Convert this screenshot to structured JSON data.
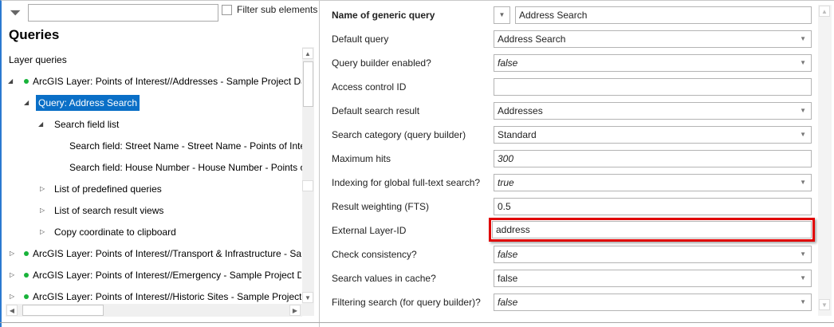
{
  "filter": {
    "placeholder": "",
    "checkbox_label": "Filter sub elements"
  },
  "title": "Queries",
  "section": "Layer queries",
  "tree": [
    {
      "label": "ArcGIS Layer: Points of Interest//Addresses - Sample Project Data - ..."
    },
    {
      "label": "Query: Address Search"
    },
    {
      "label": "Search field list"
    },
    {
      "label": "Search field: Street Name - Street Name - Points of Interest"
    },
    {
      "label": "Search field: House Number - House Number - Points of Interest"
    },
    {
      "label": "List of predefined queries"
    },
    {
      "label": "List of search result views"
    },
    {
      "label": "Copy coordinate to clipboard"
    },
    {
      "label": "ArcGIS Layer: Points of Interest//Transport & Infrastructure - Sample Project Data"
    },
    {
      "label": "ArcGIS Layer: Points of Interest//Emergency - Sample Project Data - ..."
    },
    {
      "label": "ArcGIS Layer: Points of Interest//Historic Sites - Sample Project Data"
    }
  ],
  "form": [
    {
      "label": "Name of generic query",
      "value": "Address Search"
    },
    {
      "label": "Default query",
      "value": "Address Search"
    },
    {
      "label": "Query builder enabled?",
      "value": "false"
    },
    {
      "label": "Access control ID",
      "value": ""
    },
    {
      "label": "Default search result",
      "value": "Addresses"
    },
    {
      "label": "Search category (query builder)",
      "value": "Standard"
    },
    {
      "label": "Maximum hits",
      "value": "300"
    },
    {
      "label": "Indexing for global full-text search?",
      "value": "true"
    },
    {
      "label": "Result weighting (FTS)",
      "value": "0.5"
    },
    {
      "label": "External Layer-ID",
      "value": "address"
    },
    {
      "label": "Check consistency?",
      "value": "false"
    },
    {
      "label": "Search values in cache?",
      "value": "false"
    },
    {
      "label": "Filtering search (for query builder)?",
      "value": "false"
    }
  ],
  "colors": {
    "highlight": "#e00000",
    "selection": "#0a6fc7",
    "status_dot": "#18b33a"
  }
}
